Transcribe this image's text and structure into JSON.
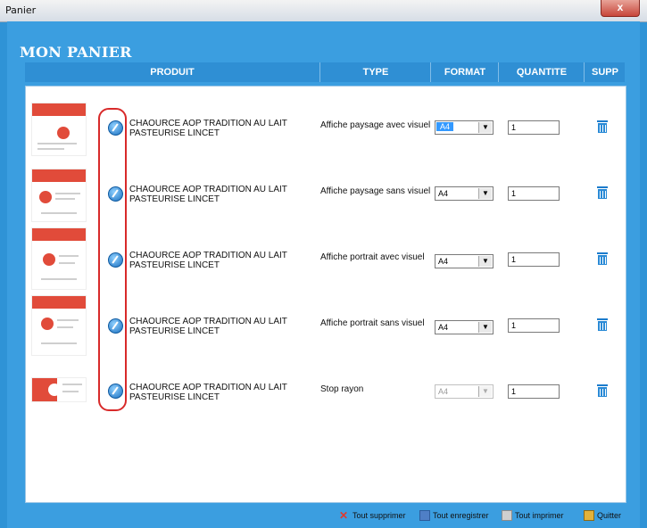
{
  "window": {
    "title": "Panier",
    "close_glyph": "x"
  },
  "page": {
    "heading": "MON PANIER"
  },
  "table": {
    "columns": [
      "PRODUIT",
      "TYPE",
      "FORMAT",
      "QUANTITE",
      "SUPP"
    ],
    "rows": [
      {
        "name": "CHAOURCE AOP TRADITION AU LAIT PASTEURISE LINCET",
        "type": "Affiche paysage avec visuel",
        "format": "A4",
        "qty": "1"
      },
      {
        "name": "CHAOURCE AOP TRADITION AU LAIT PASTEURISE LINCET",
        "type": "Affiche paysage sans visuel",
        "format": "A4",
        "qty": "1"
      },
      {
        "name": "CHAOURCE AOP TRADITION AU LAIT PASTEURISE LINCET",
        "type": "Affiche portrait avec visuel",
        "format": "A4",
        "qty": "1"
      },
      {
        "name": "CHAOURCE AOP TRADITION AU LAIT PASTEURISE LINCET",
        "type": "Affiche portrait sans visuel",
        "format": "A4",
        "qty": "1"
      },
      {
        "name": "CHAOURCE AOP TRADITION AU LAIT PASTEURISE LINCET",
        "type": "Stop rayon",
        "format": "A4",
        "qty": "1"
      }
    ]
  },
  "footer": {
    "delete_all": "Tout supprimer",
    "save_all": "Tout enregistrer",
    "print_all": "Tout imprimer",
    "quit": "Quitter"
  },
  "icons": {
    "edit": "edit-icon",
    "trash": "trash-icon",
    "delete_all": "x-icon",
    "save_all": "save-icon",
    "print_all": "printer-icon",
    "quit": "exit-icon"
  },
  "colors": {
    "accent": "#3b9ee0",
    "header": "#2f8fd4",
    "highlight": "#d82a2a"
  }
}
